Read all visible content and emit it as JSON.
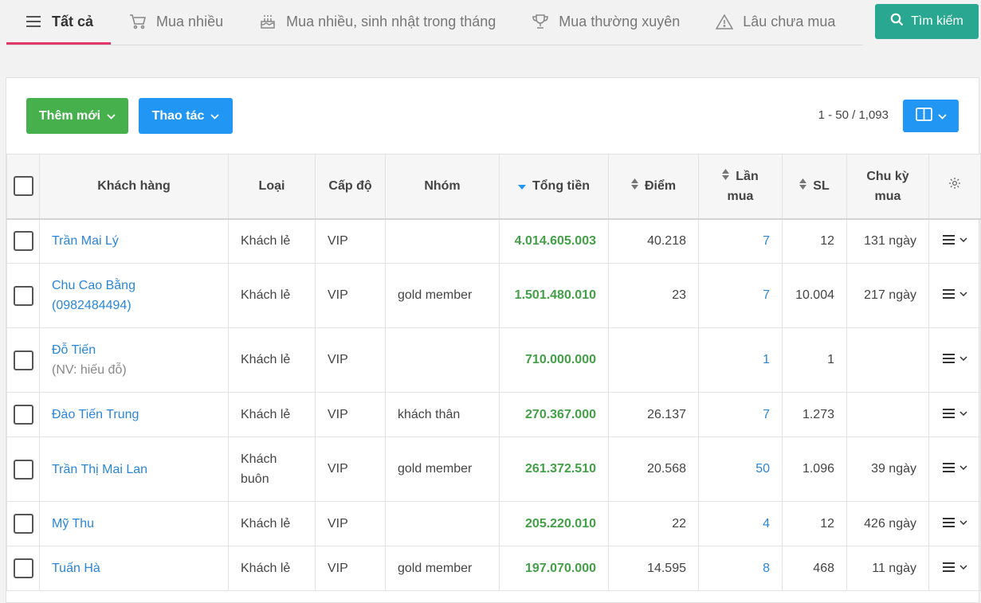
{
  "tabs": [
    {
      "label": "Tất cả",
      "icon": "list-icon",
      "active": true
    },
    {
      "label": "Mua nhiều",
      "icon": "cart-icon"
    },
    {
      "label": "Mua nhiều, sinh nhật trong tháng",
      "icon": "cake-icon"
    },
    {
      "label": "Mua thường xuyên",
      "icon": "trophy-icon"
    },
    {
      "label": "Lâu chưa mua",
      "icon": "warning-icon"
    }
  ],
  "search_button": {
    "label": "Tìm kiếm",
    "icon": "search-icon"
  },
  "toolbar": {
    "add_label": "Thêm mới",
    "action_label": "Thao tác",
    "pagination": "1 - 50 / 1,093",
    "columns_icon": "columns-icon"
  },
  "table": {
    "headers": {
      "customer": "Khách hàng",
      "type": "Loại",
      "level": "Cấp độ",
      "group": "Nhóm",
      "total": "Tổng tiền",
      "points": "Điểm",
      "purchases_line1": "Lần",
      "purchases_line2": "mua",
      "qty": "SL",
      "cycle_line1": "Chu kỳ",
      "cycle_line2": "mua"
    },
    "rows": [
      {
        "name": "Trần Mai Lý",
        "sub": "",
        "type": "Khách lẻ",
        "level": "VIP",
        "group": "",
        "total": "4.014.605.003",
        "points": "40.218",
        "purchases": "7",
        "qty": "12",
        "cycle": "131 ngày"
      },
      {
        "name": "Chu Cao Bằng (0982484494)",
        "sub": "",
        "type": "Khách lẻ",
        "level": "VIP",
        "group": "gold member",
        "total": "1.501.480.010",
        "points": "23",
        "purchases": "7",
        "qty": "10.004",
        "cycle": "217 ngày"
      },
      {
        "name": "Đỗ Tiến",
        "sub": "(NV: hiếu đỗ)",
        "type": "Khách lẻ",
        "level": "VIP",
        "group": "",
        "total": "710.000.000",
        "points": "",
        "purchases": "1",
        "qty": "1",
        "cycle": ""
      },
      {
        "name": "Đào Tiến Trung",
        "sub": "",
        "type": "Khách lẻ",
        "level": "VIP",
        "group": "khách thân",
        "total": "270.367.000",
        "points": "26.137",
        "purchases": "7",
        "qty": "1.273",
        "cycle": ""
      },
      {
        "name": "Trần Thị Mai Lan",
        "sub": "",
        "type": "Khách buôn",
        "level": "VIP",
        "group": "gold member",
        "total": "261.372.510",
        "points": "20.568",
        "purchases": "50",
        "qty": "1.096",
        "cycle": "39 ngày"
      },
      {
        "name": "Mỹ Thu",
        "sub": "",
        "type": "Khách lẻ",
        "level": "VIP",
        "group": "",
        "total": "205.220.010",
        "points": "22",
        "purchases": "4",
        "qty": "12",
        "cycle": "426 ngày"
      },
      {
        "name": "Tuấn Hà",
        "sub": "",
        "type": "Khách lẻ",
        "level": "VIP",
        "group": "gold member",
        "total": "197.070.000",
        "points": "14.595",
        "purchases": "8",
        "qty": "468",
        "cycle": "11 ngày"
      }
    ]
  }
}
